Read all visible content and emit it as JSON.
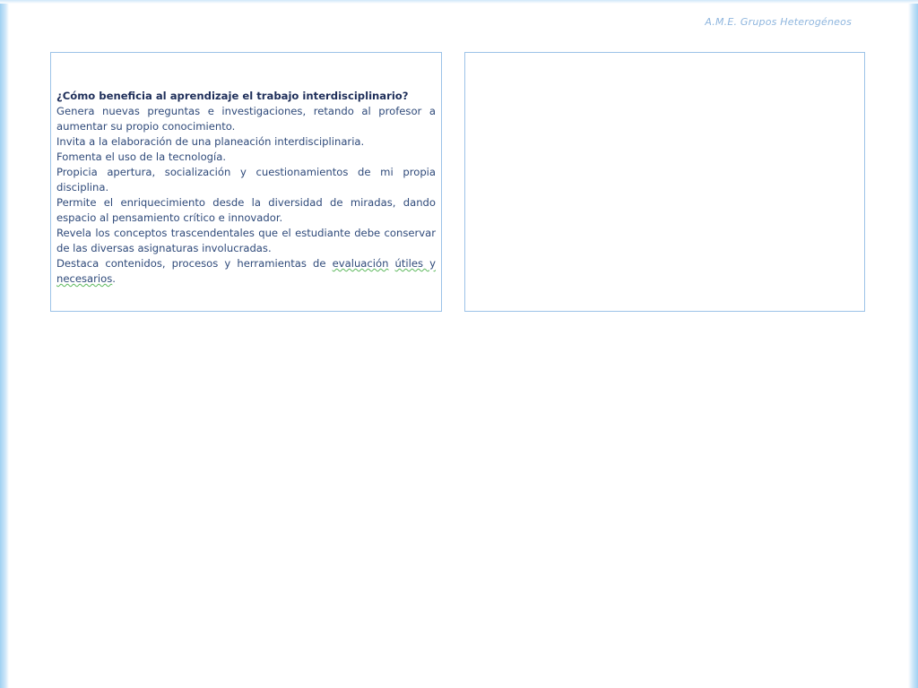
{
  "header": {
    "note": "A.M.E. Grupos Heterogéneos"
  },
  "left_panel": {
    "title": "¿Cómo beneficia  al aprendizaje el trabajo interdisciplinario?",
    "paragraphs": [
      "Genera nuevas preguntas e investigaciones, retando al profesor a aumentar su propio conocimiento.",
      "Invita a la elaboración de una planeación interdisciplinaria.",
      "Fomenta el uso de la tecnología.",
      "Propicia apertura, socialización  y cuestionamientos de mi propia disciplina.",
      "Permite el enriquecimiento desde la diversidad de miradas, dando espacio al pensamiento crítico e innovador.",
      "Revela los conceptos trascendentales que el estudiante debe conservar de las diversas asignaturas involucradas."
    ],
    "last_paragraph": {
      "before": "Destaca contenidos, procesos y herramientas de ",
      "flagged_1": "evaluación",
      "space": " ",
      "flagged_2": "útiles y necesarios",
      "after": "."
    }
  },
  "right_panel": {}
}
